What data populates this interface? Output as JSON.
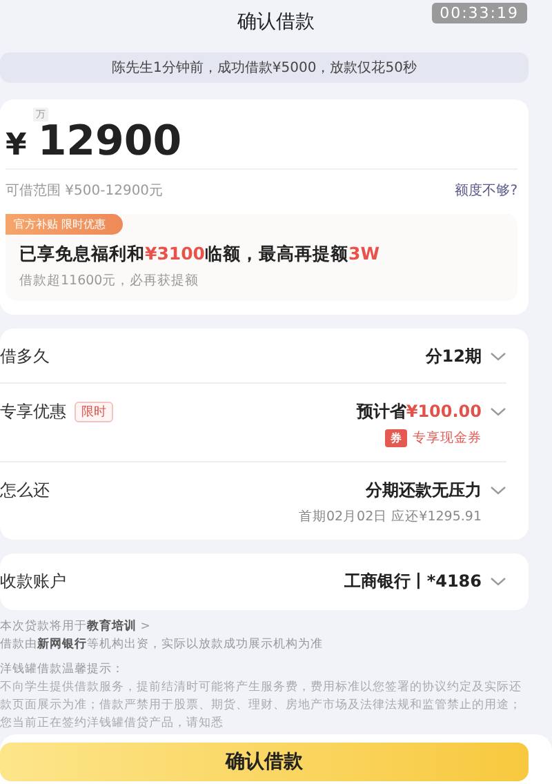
{
  "header": {
    "title": "确认借款",
    "timer": "00:33:19"
  },
  "notice": "陈先生1分钟前，成功借款¥5000，放款仅花50秒",
  "amount": {
    "unit": "万",
    "currency": "¥",
    "value": "12900",
    "range": "可借范围 ¥500-12900元",
    "link": "额度不够?"
  },
  "promo": {
    "tag": "官方补贴 限时优惠",
    "headline": "已享免息福利和**¥3100**临额，最高再提额**3W**",
    "sub": "借款超11600元，必再获提额"
  },
  "options": [
    {
      "label": "借多久",
      "value": "分12期"
    },
    {
      "label": "专享优惠",
      "badge": "限时",
      "value": "预计省**¥100.00**",
      "coupon_icon": "券",
      "coupon": "专享现金券"
    },
    {
      "label": "怎么还",
      "value": "分期还款无压力",
      "sub": "首期02月02日 应还¥1295.91"
    }
  ],
  "account": {
    "label": "收款账户",
    "value": "工商银行丨*4186"
  },
  "notes": [
    "本次贷款将用于**教育培训** >",
    "借款由**新网银行**等机构出资，实际以放款成功展示机构为准"
  ],
  "tips": {
    "title": "洋钱罐借款温馨提示：",
    "body": "不向学生提供借款服务，提前结清时可能将产生服务费，费用标准以您签署的协议约定及实际还款页面展示为准；借款严禁用于股票、期货、理财、房地产市场及法律法规和监管禁止的用途；您当前正在签约洋钱罐借贷产品，请知悉"
  },
  "button": "确认借款"
}
